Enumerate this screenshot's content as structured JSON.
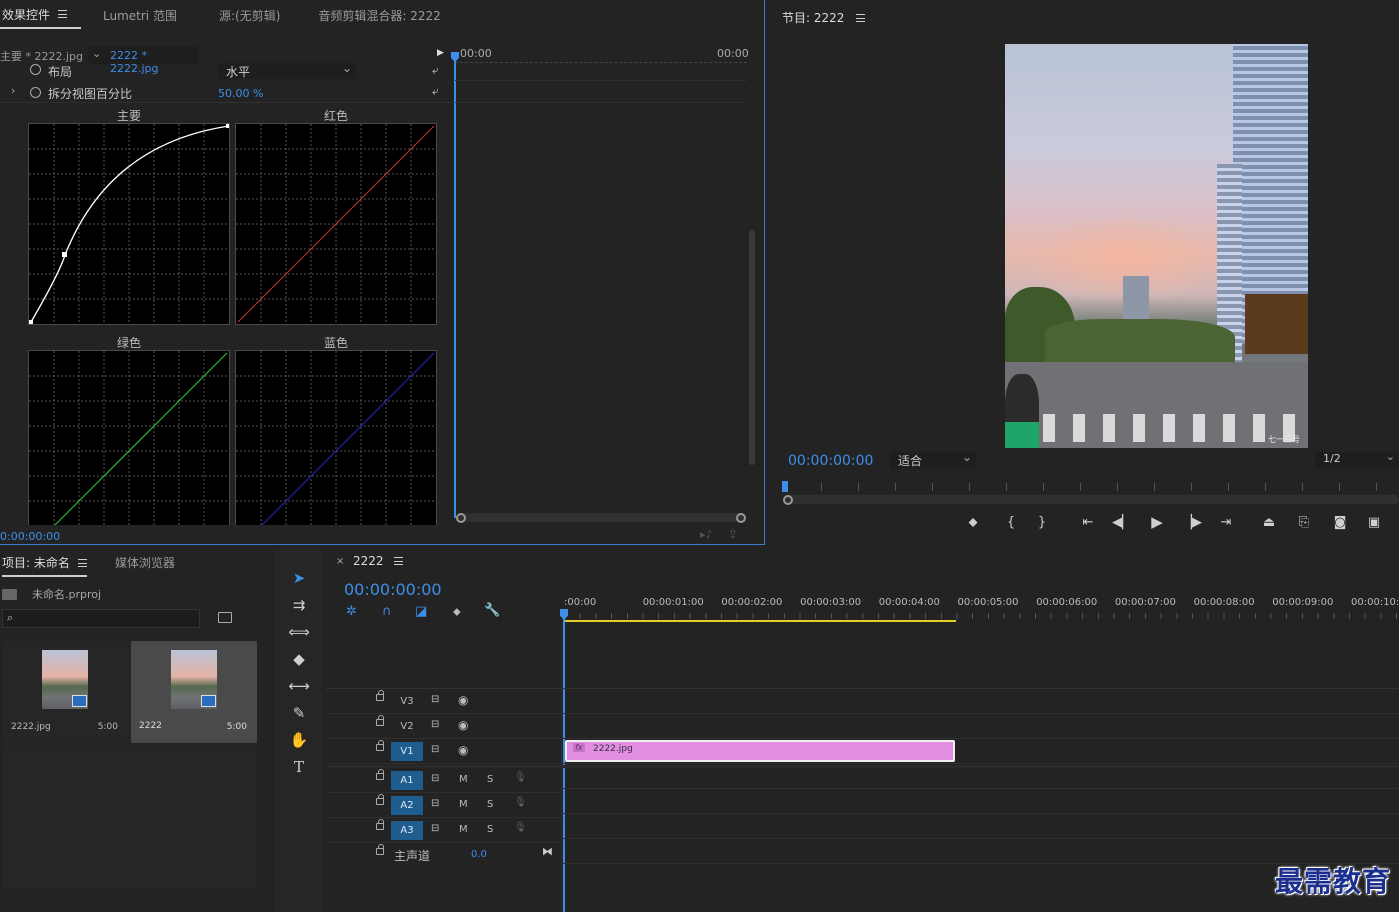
{
  "effects": {
    "tabs": [
      "效果控件",
      "Lumetri 范围",
      "源:(无剪辑)",
      "音频剪辑混合器: 2222"
    ],
    "master_label": "主要 * 2222.jpg",
    "clip_label": "2222 * 2222.jpg",
    "time_start": "00:00",
    "time_end": "00:00",
    "layout_label": "布局",
    "layout_value": "水平",
    "split_label": "拆分视图百分比",
    "split_value": "50.00 %",
    "curves": {
      "master": "主要",
      "red": "红色",
      "green": "绿色",
      "blue": "蓝色"
    },
    "timecode": "0:00:00:00",
    "curve_colors": {
      "master": "#ffffff",
      "red": "#c0392b",
      "green": "#2ecc40",
      "blue": "#2424c8"
    }
  },
  "program": {
    "title": "节目: 2222",
    "timecode": "00:00:00:00",
    "fit": "适合",
    "resolution": "1/2",
    "watermark": "七一三号"
  },
  "project": {
    "tabs": [
      "项目: 未命名",
      "媒体浏览器"
    ],
    "file": "未命名.prproj",
    "search_placeholder": "",
    "items": [
      {
        "name": "2222.jpg",
        "dur": "5:00"
      },
      {
        "name": "2222",
        "dur": "5:00"
      }
    ]
  },
  "timeline": {
    "title": "2222",
    "timecode": "00:00:00:00",
    "ruler": [
      ":00:00",
      "00:00:01:00",
      "00:00:02:00",
      "00:00:03:00",
      "00:00:04:00",
      "00:00:05:00",
      "00:00:06:00",
      "00:00:07:00",
      "00:00:08:00",
      "00:00:09:00",
      "00:00:10:00"
    ],
    "tracks": {
      "v3": "V3",
      "v2": "V2",
      "v1": "V1",
      "a1": "A1",
      "a2": "A2",
      "a3": "A3"
    },
    "mute": "M",
    "solo": "S",
    "master": "主声道",
    "master_value": "0.0",
    "clip": "2222.jpg",
    "clip_fx": "fx",
    "clip_color": "#e28ee2"
  },
  "brand": "最需教育"
}
